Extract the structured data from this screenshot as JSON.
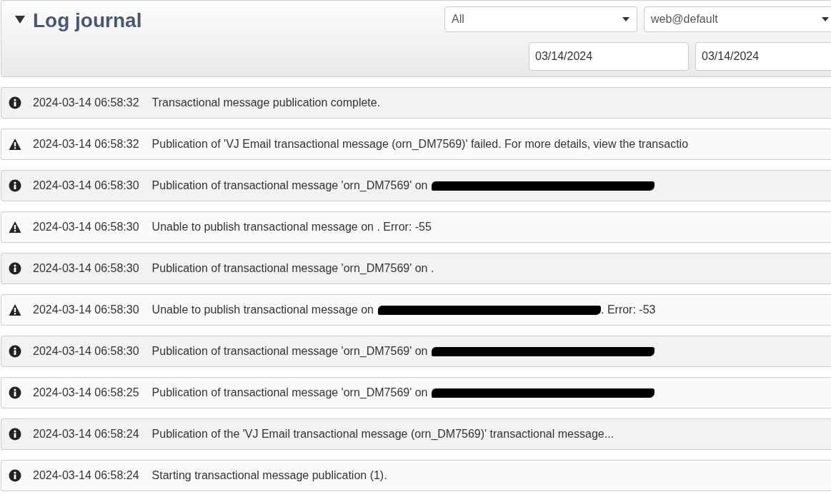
{
  "panel": {
    "title": "Log journal",
    "expanded": true
  },
  "filters": {
    "selects": [
      {
        "value": "All"
      },
      {
        "value": "web@default"
      }
    ],
    "dates": [
      {
        "value": "03/14/2024"
      },
      {
        "value": "03/14/2024"
      }
    ]
  },
  "entries": [
    {
      "kind": "info",
      "time": "2024-03-14 06:58:32",
      "message": "Transactional message publication complete."
    },
    {
      "kind": "warning",
      "time": "2024-03-14 06:58:32",
      "message": "Publication of 'VJ Email transactional message (orn_DM7569)' failed. For more details, view the transactio"
    },
    {
      "kind": "info",
      "time": "2024-03-14 06:58:30",
      "message": "Publication of transactional message 'orn_DM7569' on",
      "redacted": true
    },
    {
      "kind": "warning",
      "time": "2024-03-14 06:58:30",
      "message": "Unable to publish transactional message on . Error: -55"
    },
    {
      "kind": "info",
      "time": "2024-03-14 06:58:30",
      "message": "Publication of transactional message 'orn_DM7569' on ."
    },
    {
      "kind": "warning",
      "time": "2024-03-14 06:58:30",
      "message": "Unable to publish transactional message on",
      "redacted": true,
      "message_after": ". Error: -53"
    },
    {
      "kind": "info",
      "time": "2024-03-14 06:58:30",
      "message": "Publication of transactional message 'orn_DM7569' on",
      "redacted": true
    },
    {
      "kind": "info",
      "time": "2024-03-14 06:58:25",
      "message": "Publication of transactional message 'orn_DM7569' on",
      "redacted": true
    },
    {
      "kind": "info",
      "time": "2024-03-14 06:58:24",
      "message": "Publication of the 'VJ Email transactional message (orn_DM7569)' transactional message..."
    },
    {
      "kind": "info",
      "time": "2024-03-14 06:58:24",
      "message": "Starting transactional message publication (1)."
    }
  ]
}
